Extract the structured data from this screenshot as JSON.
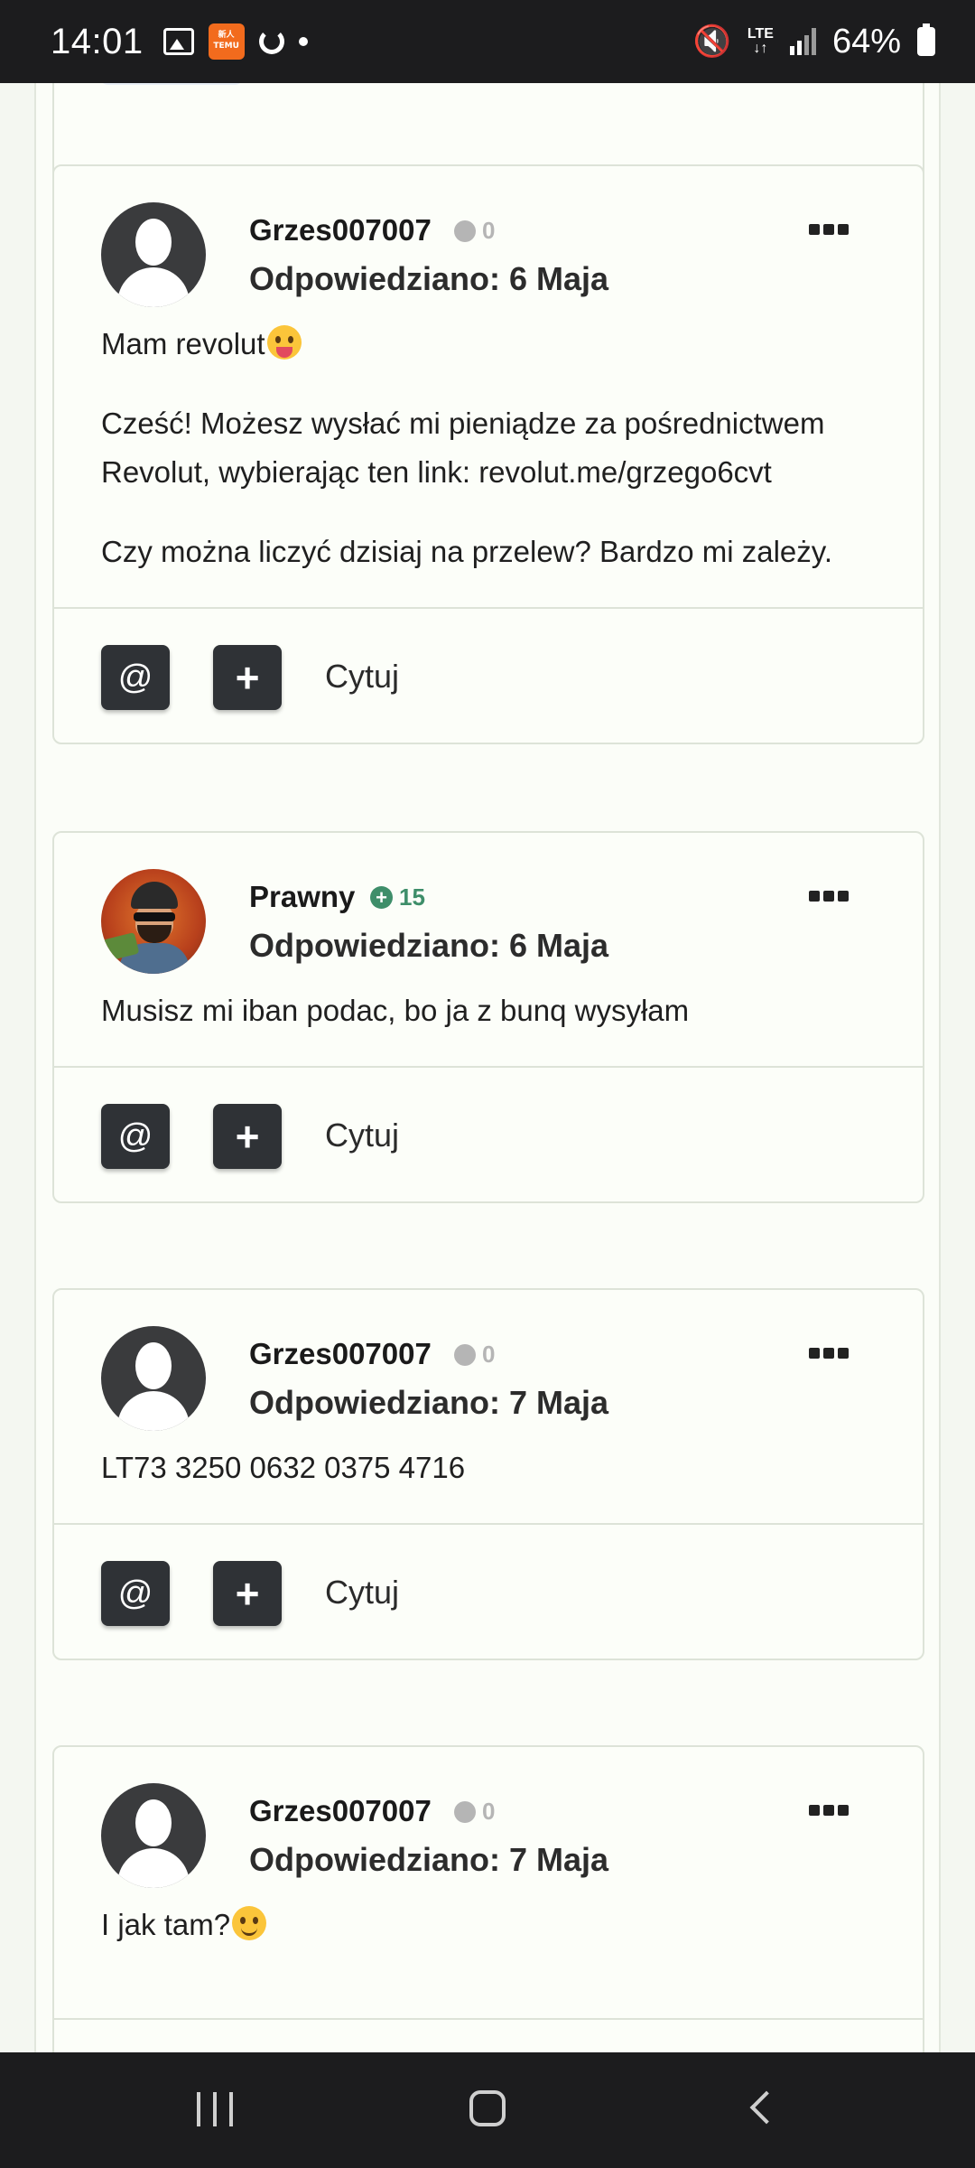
{
  "status_bar": {
    "time": "14:01",
    "temu_label": "Temu",
    "network": "LTE",
    "battery": "64%",
    "icons": [
      "image-icon",
      "temu-app-icon",
      "sync-icon",
      "dot-icon",
      "mute-icon",
      "lte-icon",
      "signal-icon",
      "battery-icon"
    ]
  },
  "posts": [
    {
      "author": "Grzes007007",
      "reputation": "0",
      "reputation_type": "neutral",
      "date": "Odpowiedziano: 6 Maja",
      "body": [
        "Mam revolut",
        "Cześć! Możesz wysłać mi pieniądze za pośrednictwem Revolut, wybierając ten link: revolut.me/grzego6cvt",
        "Czy można liczyć dzisiaj na przelew? Bardzo mi zależy."
      ]
    },
    {
      "author": "Prawny",
      "reputation": "15",
      "reputation_type": "positive",
      "date": "Odpowiedziano: 6 Maja",
      "body": [
        "Musisz mi iban podac, bo ja z bunq wysyłam"
      ]
    },
    {
      "author": "Grzes007007",
      "reputation": "0",
      "reputation_type": "neutral",
      "date": "Odpowiedziano: 7 Maja",
      "body": [
        "LT73 3250 0632 0375 4716"
      ]
    },
    {
      "author": "Grzes007007",
      "reputation": "0",
      "reputation_type": "neutral",
      "date": "Odpowiedziano: 7 Maja",
      "body": [
        "I jak tam?"
      ]
    }
  ],
  "actions": {
    "mention": "@",
    "multiquote": "+",
    "quote": "Cytuj"
  },
  "colors": {
    "background": "#f4f7f1",
    "card": "#fcfef9",
    "button": "#2f3236",
    "rep_positive": "#3e8e6a",
    "rep_neutral": "#b5b5b5"
  }
}
